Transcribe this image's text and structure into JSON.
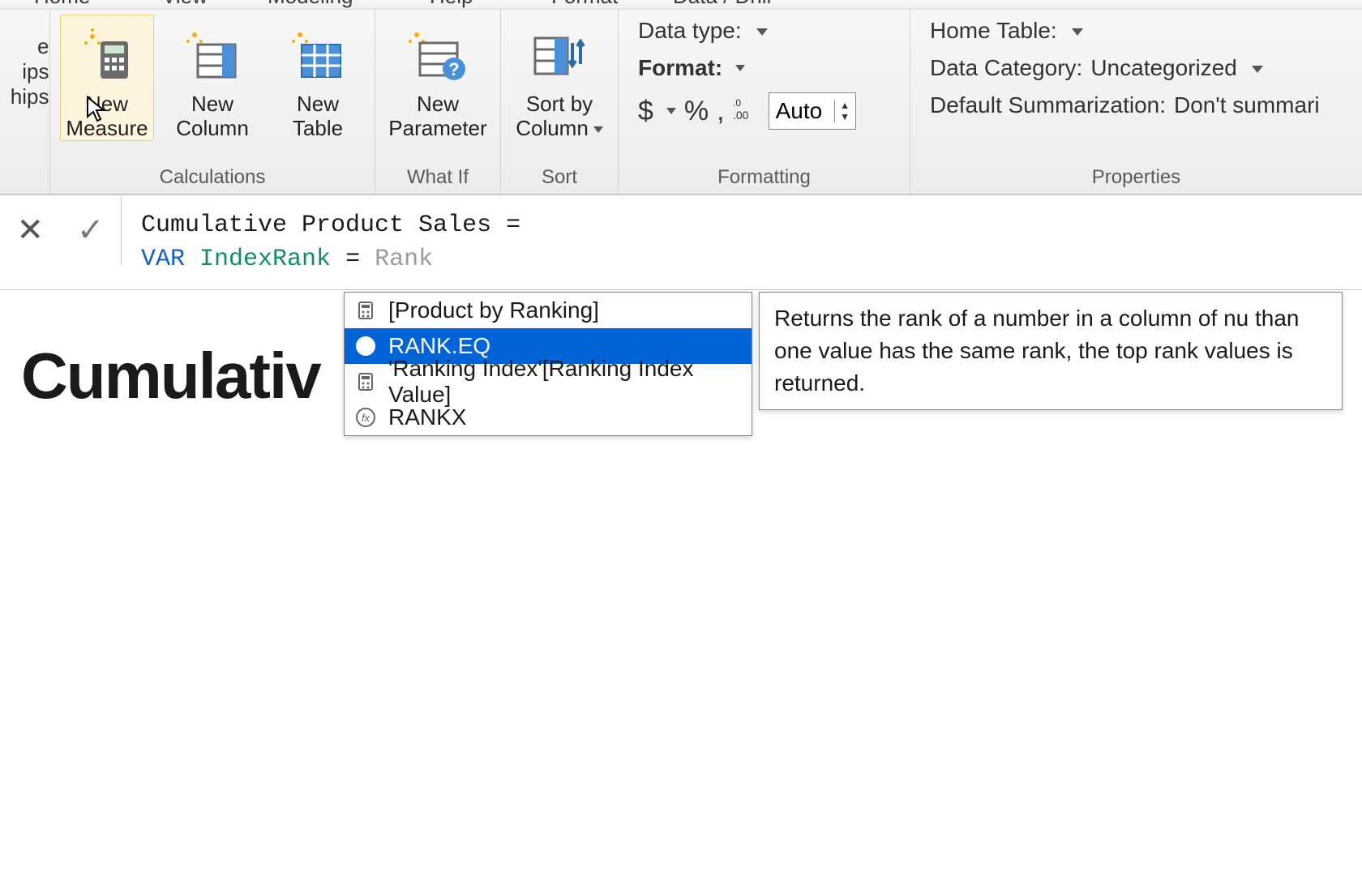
{
  "tabs": {
    "home": "Home",
    "view": "View",
    "modeling": "Modeling",
    "help": "Help",
    "format": "Format",
    "data_drill": "Data / Drill"
  },
  "side": {
    "row0_suffix": "e",
    "row1_suffix": "ips",
    "row2_suffix": "hips"
  },
  "ribbon": {
    "calculations": {
      "caption": "Calculations",
      "new_measure": "New\nMeasure",
      "new_column": "New\nColumn",
      "new_table": "New\nTable"
    },
    "whatif": {
      "caption": "What If",
      "new_parameter": "New\nParameter"
    },
    "sort": {
      "caption": "Sort",
      "sort_by_column": "Sort by\nColumn"
    },
    "formatting": {
      "caption": "Formatting",
      "data_type_label": "Data type:",
      "format_label": "Format:",
      "currency_glyph": "$",
      "percent_glyph": "%",
      "thousands_glyph": ",",
      "decimal_glyph": ".00",
      "auto_value": "Auto"
    },
    "properties": {
      "caption": "Properties",
      "home_table_label": "Home Table:",
      "data_category_label": "Data Category:",
      "data_category_value": "Uncategorized",
      "summarization_label": "Default Summarization:",
      "summarization_value": "Don't summari"
    }
  },
  "formula": {
    "line1_plain": "Cumulative Product Sales =",
    "line2_kw": "VAR",
    "line2_ident": "IndexRank",
    "line2_eq": "=",
    "line2_ghost": "Rank"
  },
  "intellisense": {
    "items": [
      {
        "kind": "calc",
        "label": "[Product by Ranking]"
      },
      {
        "kind": "fx",
        "label": "RANK.EQ",
        "selected": true
      },
      {
        "kind": "calc",
        "label": "'Ranking Index'[Ranking Index Value]"
      },
      {
        "kind": "fx",
        "label": "RANKX"
      }
    ],
    "tooltip": "Returns the rank of a number in a column of nu​ than one value has the same rank, the top rank​ values is returned."
  },
  "canvas": {
    "partial_title": "Cumulativ"
  }
}
